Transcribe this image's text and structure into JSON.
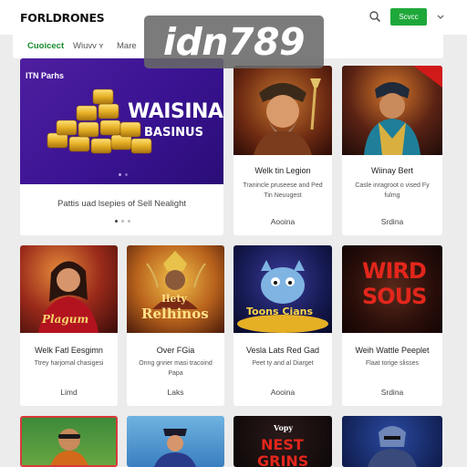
{
  "header": {
    "brand": "FORLDRONES",
    "search_icon": "search-icon",
    "button_label": "Scvcc",
    "account_icon": "chevron-down-icon"
  },
  "nav": {
    "items": [
      {
        "label": "Cuoicect",
        "active": true
      },
      {
        "label": "Wiuvv ʏ",
        "active": false
      },
      {
        "label": "Mare",
        "active": false
      }
    ]
  },
  "watermark": "idn789",
  "hero": {
    "logo_text": "ITN Parhs",
    "headline": "WAISINA",
    "subline": "BASINUS",
    "caption": "Pattis uad lsepies of Sell Nealight",
    "slides": 3,
    "active_slide": 0
  },
  "games_row1": [
    {
      "title": "Welk tin Legion",
      "desc": "Tranincle pruseese and Ped Tin Neuugest",
      "foot": "Aooina"
    },
    {
      "title": "Wiinay Bert",
      "desc": "Casle inragroot o vised Fy fulmg",
      "foot": "Srdina"
    }
  ],
  "games_row2": [
    {
      "title": "Welk Fatl Eesgimn",
      "desc": "Ttrey harjomal chasigesi",
      "foot": "Limd",
      "art_text": "Plagum"
    },
    {
      "title": "Over FGia",
      "desc": "Onng gnrier masi tracoind Papa",
      "foot": "Laks",
      "art_text_1": "Ilety",
      "art_text_2": "Relhinos"
    },
    {
      "title": "Vesla Lats Red Gad",
      "desc": "Peet ty and al Diarget",
      "foot": "Aooina",
      "art_text": "Toons Cians"
    },
    {
      "title": "Weih Wattle Peeplet",
      "desc": "Flaat torige slisses",
      "foot": "Srdina",
      "art_text_1": "WIRD",
      "art_text_2": "SOUS"
    }
  ],
  "games_row3": [
    {
      "art_text_1": "Vopy",
      "art_text_2": "NEST",
      "art_text_3": "GRINS"
    }
  ],
  "colors": {
    "brand_green": "#1fa83a",
    "nav_active": "#168a2d",
    "hero_purple": "#3a1392",
    "page_bg": "#ececec"
  }
}
